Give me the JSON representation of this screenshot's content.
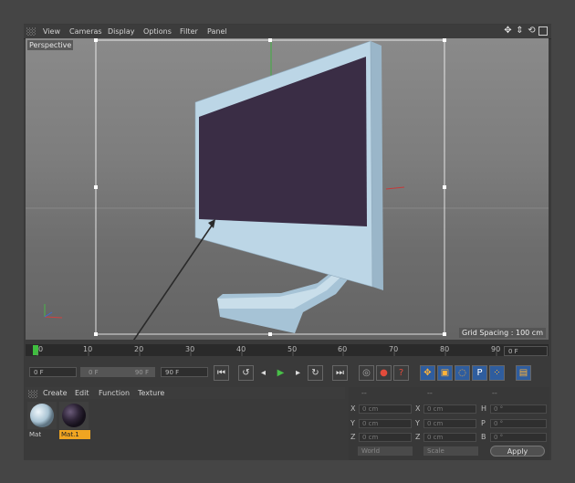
{
  "menubar": {
    "items": [
      "View",
      "Cameras",
      "Display",
      "Options",
      "Filter",
      "Panel"
    ]
  },
  "viewport": {
    "label": "Perspective",
    "grid_spacing": "Grid Spacing : 100 cm",
    "screen_color": "#3a2d45",
    "monitor_color": "#bcd6e6",
    "selection_color": "#ffffff"
  },
  "timeline": {
    "ticks": [
      "0",
      "10",
      "20",
      "30",
      "40",
      "50",
      "60",
      "70",
      "80",
      "90"
    ],
    "current_frame": "0 F"
  },
  "transport": {
    "start_frame": "0 F",
    "range_start": "0 F",
    "range_end": "90 F",
    "end_frame": "90 F"
  },
  "lower_menubar": {
    "items": [
      "Create",
      "Edit",
      "Function",
      "Texture"
    ]
  },
  "materials": [
    {
      "name": "Mat",
      "selected": false
    },
    {
      "name": "Mat.1",
      "selected": true
    }
  ],
  "coordinates": {
    "dashes": [
      "--",
      "--",
      "--"
    ],
    "rows": [
      {
        "a": "X",
        "a_val": "0 cm",
        "b": "X",
        "b_val": "0 cm",
        "c": "H",
        "c_val": "0 °"
      },
      {
        "a": "Y",
        "a_val": "0 cm",
        "b": "Y",
        "b_val": "0 cm",
        "c": "P",
        "c_val": "0 °"
      },
      {
        "a": "Z",
        "a_val": "0 cm",
        "b": "Z",
        "b_val": "0 cm",
        "c": "B",
        "c_val": "0 °"
      }
    ],
    "mode_world": "World",
    "mode_scale": "Scale",
    "apply_label": "Apply"
  }
}
